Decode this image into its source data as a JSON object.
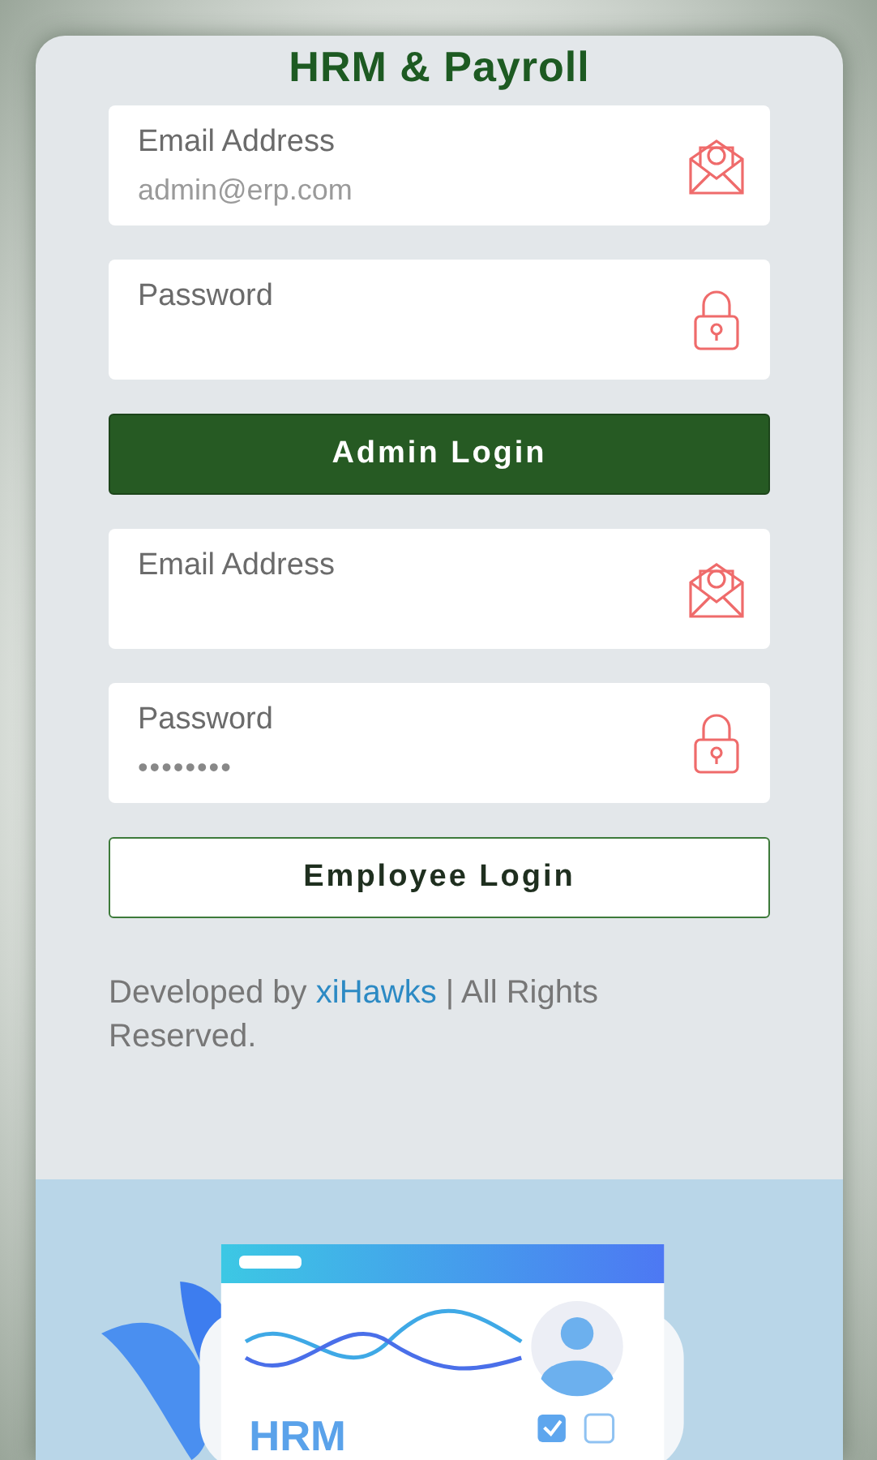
{
  "title": "HRM & Payroll",
  "admin": {
    "fields": [
      {
        "kind": "email",
        "label": "Email Address",
        "placeholder": "admin@erp.com"
      },
      {
        "kind": "password",
        "label": "Password"
      }
    ],
    "button": "Admin Login"
  },
  "employee": {
    "fields": [
      {
        "kind": "email",
        "label": "Email Address"
      },
      {
        "kind": "password",
        "label": "Password",
        "value": "••••••••"
      }
    ],
    "button": "Employee Login"
  },
  "footer": {
    "before": "Developed by ",
    "link": "xiHawks",
    "after": " | All Rights Reserved."
  },
  "illustration": {
    "label": "HRM"
  }
}
